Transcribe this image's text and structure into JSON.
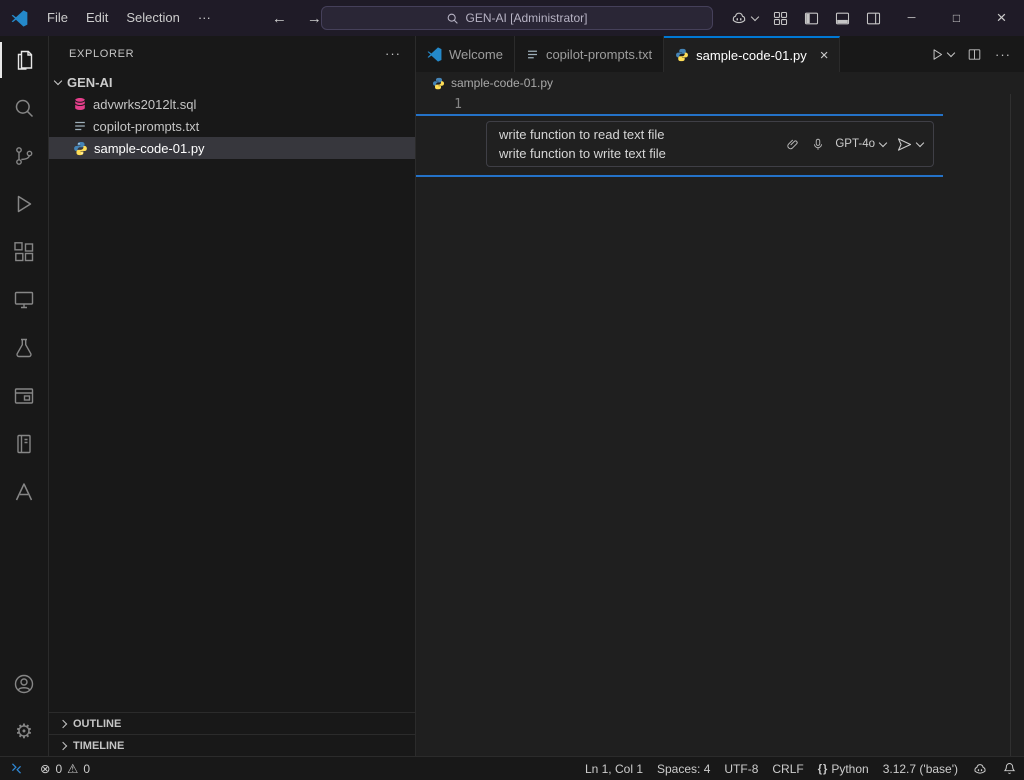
{
  "icons": {
    "gear": "⚙",
    "error": "⊗",
    "warning": "⚠",
    "ellipsis": "···",
    "back": "←",
    "forward": "→",
    "minimize": "─",
    "maximize": "□",
    "close": "×",
    "braces": "{ }"
  },
  "titlebar": {
    "menus": [
      "File",
      "Edit",
      "Selection"
    ],
    "search_text": "GEN-AI [Administrator]"
  },
  "explorer": {
    "title": "EXPLORER",
    "folder": "GEN-AI",
    "files": [
      {
        "name": "advwrks2012lt.sql",
        "type": "sql"
      },
      {
        "name": "copilot-prompts.txt",
        "type": "txt"
      },
      {
        "name": "sample-code-01.py",
        "type": "python",
        "selected": true
      }
    ],
    "outline": "OUTLINE",
    "timeline": "TIMELINE"
  },
  "editor": {
    "tabs": [
      {
        "label": "Welcome",
        "icon": "vscode"
      },
      {
        "label": "copilot-prompts.txt",
        "icon": "txt"
      },
      {
        "label": "sample-code-01.py",
        "icon": "python",
        "active": true
      }
    ],
    "breadcrumb": "sample-code-01.py",
    "line_number": "1",
    "inline_chat": {
      "line1": "write function to read text file",
      "line2": "write function to write text file",
      "model": "GPT-4o"
    }
  },
  "status_bar": {
    "errors": "0",
    "warnings": "0",
    "cursor": "Ln 1, Col 1",
    "indent": "Spaces: 4",
    "encoding": "UTF-8",
    "eol": "CRLF",
    "language": "Python",
    "interpreter": "3.12.7 ('base')"
  },
  "colors": {
    "accent": "#0078d4",
    "focus_line": "#2472c8",
    "selection_bg": "#37373d",
    "titlebar_bg": "#1f1b27"
  }
}
